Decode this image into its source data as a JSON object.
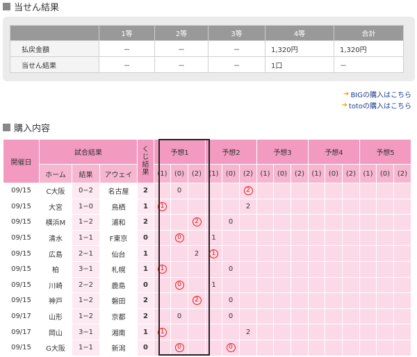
{
  "result_section": {
    "title": "当せん結果",
    "headers": [
      "",
      "1等",
      "2等",
      "3等",
      "4等",
      "合計"
    ],
    "rows": [
      {
        "label": "払戻金額",
        "values": [
          "－",
          "－",
          "－",
          "1,320円",
          "1,320円"
        ]
      },
      {
        "label": "当せん結果",
        "values": [
          "－",
          "－",
          "－",
          "1口",
          "－"
        ]
      }
    ]
  },
  "links": {
    "big": "BIGの購入はこちら",
    "toto": "totoの購入はこちら"
  },
  "purchase_section": {
    "title": "購入内容",
    "headers": {
      "date": "開催日",
      "match_result": "試合結果",
      "kuji": "くじ結果",
      "home": "ホーム",
      "result": "結果",
      "away": "アウェイ",
      "yosou": [
        "予想1",
        "予想2",
        "予想3",
        "予想4",
        "予想5"
      ],
      "choices": [
        "(1)",
        "(0)",
        "(2)"
      ]
    },
    "rows": [
      {
        "date": "09/15",
        "home": "C大阪",
        "score": "0−2",
        "away": "名古屋",
        "kuji": "2",
        "p": [
          [
            "",
            "0",
            ""
          ],
          [
            "",
            "",
            "2"
          ],
          [
            "",
            "",
            ""
          ],
          [
            "",
            "",
            ""
          ],
          [
            "",
            "",
            ""
          ]
        ],
        "c": [
          [
            0,
            0,
            0
          ],
          [
            0,
            0,
            1
          ],
          [
            0,
            0,
            0
          ],
          [
            0,
            0,
            0
          ],
          [
            0,
            0,
            0
          ]
        ]
      },
      {
        "date": "09/15",
        "home": "大宮",
        "score": "1−0",
        "away": "鳥栖",
        "kuji": "1",
        "p": [
          [
            "1",
            "",
            ""
          ],
          [
            "",
            "",
            "2"
          ],
          [
            "",
            "",
            ""
          ],
          [
            "",
            "",
            ""
          ],
          [
            "",
            "",
            ""
          ]
        ],
        "c": [
          [
            1,
            0,
            0
          ],
          [
            0,
            0,
            0
          ],
          [
            0,
            0,
            0
          ],
          [
            0,
            0,
            0
          ],
          [
            0,
            0,
            0
          ]
        ]
      },
      {
        "date": "09/15",
        "home": "横浜M",
        "score": "1−2",
        "away": "浦和",
        "kuji": "2",
        "p": [
          [
            "",
            "",
            "2"
          ],
          [
            "",
            "0",
            ""
          ],
          [
            "",
            "",
            ""
          ],
          [
            "",
            "",
            ""
          ],
          [
            "",
            "",
            ""
          ]
        ],
        "c": [
          [
            0,
            0,
            1
          ],
          [
            0,
            0,
            0
          ],
          [
            0,
            0,
            0
          ],
          [
            0,
            0,
            0
          ],
          [
            0,
            0,
            0
          ]
        ]
      },
      {
        "date": "09/15",
        "home": "清水",
        "score": "1−1",
        "away": "F東京",
        "kuji": "0",
        "p": [
          [
            "",
            "0",
            ""
          ],
          [
            "1",
            "",
            ""
          ],
          [
            "",
            "",
            ""
          ],
          [
            "",
            "",
            ""
          ],
          [
            "",
            "",
            ""
          ]
        ],
        "c": [
          [
            0,
            1,
            0
          ],
          [
            0,
            0,
            0
          ],
          [
            0,
            0,
            0
          ],
          [
            0,
            0,
            0
          ],
          [
            0,
            0,
            0
          ]
        ]
      },
      {
        "date": "09/15",
        "home": "広島",
        "score": "2−1",
        "away": "仙台",
        "kuji": "1",
        "p": [
          [
            "",
            "",
            "2"
          ],
          [
            "1",
            "",
            ""
          ],
          [
            "",
            "",
            ""
          ],
          [
            "",
            "",
            ""
          ],
          [
            "",
            "",
            ""
          ]
        ],
        "c": [
          [
            0,
            0,
            0
          ],
          [
            1,
            0,
            0
          ],
          [
            0,
            0,
            0
          ],
          [
            0,
            0,
            0
          ],
          [
            0,
            0,
            0
          ]
        ]
      },
      {
        "date": "09/15",
        "home": "柏",
        "score": "3−1",
        "away": "札幌",
        "kuji": "1",
        "p": [
          [
            "1",
            "",
            ""
          ],
          [
            "",
            "0",
            ""
          ],
          [
            "",
            "",
            ""
          ],
          [
            "",
            "",
            ""
          ],
          [
            "",
            "",
            ""
          ]
        ],
        "c": [
          [
            1,
            0,
            0
          ],
          [
            0,
            0,
            0
          ],
          [
            0,
            0,
            0
          ],
          [
            0,
            0,
            0
          ],
          [
            0,
            0,
            0
          ]
        ]
      },
      {
        "date": "09/15",
        "home": "川崎",
        "score": "2−2",
        "away": "鹿島",
        "kuji": "0",
        "p": [
          [
            "",
            "0",
            ""
          ],
          [
            "1",
            "",
            ""
          ],
          [
            "",
            "",
            ""
          ],
          [
            "",
            "",
            ""
          ],
          [
            "",
            "",
            ""
          ]
        ],
        "c": [
          [
            0,
            1,
            0
          ],
          [
            0,
            0,
            0
          ],
          [
            0,
            0,
            0
          ],
          [
            0,
            0,
            0
          ],
          [
            0,
            0,
            0
          ]
        ]
      },
      {
        "date": "09/15",
        "home": "神戸",
        "score": "1−2",
        "away": "磐田",
        "kuji": "2",
        "p": [
          [
            "",
            "",
            "2"
          ],
          [
            "",
            "0",
            ""
          ],
          [
            "",
            "",
            ""
          ],
          [
            "",
            "",
            ""
          ],
          [
            "",
            "",
            ""
          ]
        ],
        "c": [
          [
            0,
            0,
            1
          ],
          [
            0,
            0,
            0
          ],
          [
            0,
            0,
            0
          ],
          [
            0,
            0,
            0
          ],
          [
            0,
            0,
            0
          ]
        ]
      },
      {
        "date": "09/17",
        "home": "山形",
        "score": "1−2",
        "away": "京都",
        "kuji": "2",
        "p": [
          [
            "",
            "0",
            ""
          ],
          [
            "",
            "0",
            ""
          ],
          [
            "",
            "",
            ""
          ],
          [
            "",
            "",
            ""
          ],
          [
            "",
            "",
            ""
          ]
        ],
        "c": [
          [
            0,
            0,
            0
          ],
          [
            0,
            0,
            0
          ],
          [
            0,
            0,
            0
          ],
          [
            0,
            0,
            0
          ],
          [
            0,
            0,
            0
          ]
        ]
      },
      {
        "date": "09/17",
        "home": "岡山",
        "score": "3−1",
        "away": "湘南",
        "kuji": "1",
        "p": [
          [
            "1",
            "",
            ""
          ],
          [
            "",
            "",
            "2"
          ],
          [
            "",
            "",
            ""
          ],
          [
            "",
            "",
            ""
          ],
          [
            "",
            "",
            ""
          ]
        ],
        "c": [
          [
            1,
            0,
            0
          ],
          [
            0,
            0,
            0
          ],
          [
            0,
            0,
            0
          ],
          [
            0,
            0,
            0
          ],
          [
            0,
            0,
            0
          ]
        ]
      },
      {
        "date": "09/15",
        "home": "G大阪",
        "score": "1−1",
        "away": "新潟",
        "kuji": "0",
        "p": [
          [
            "",
            "0",
            ""
          ],
          [
            "",
            "0",
            ""
          ],
          [
            "",
            "",
            ""
          ],
          [
            "",
            "",
            ""
          ],
          [
            "",
            "",
            ""
          ]
        ],
        "c": [
          [
            0,
            1,
            0
          ],
          [
            0,
            1,
            0
          ],
          [
            0,
            0,
            0
          ],
          [
            0,
            0,
            0
          ],
          [
            0,
            0,
            0
          ]
        ]
      }
    ]
  }
}
